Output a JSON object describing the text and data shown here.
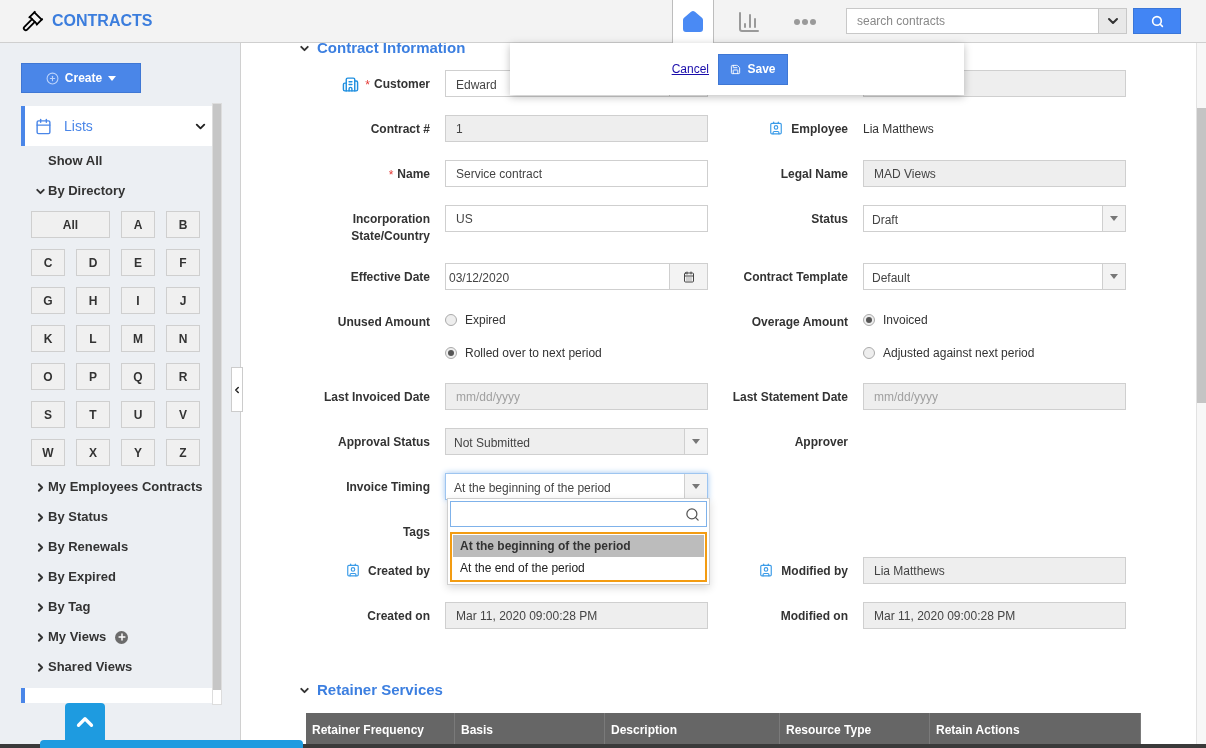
{
  "header": {
    "app_title": "CONTRACTS",
    "nav": [
      {
        "kind": "home",
        "selected": true
      },
      {
        "kind": "reports",
        "selected": false
      },
      {
        "kind": "more",
        "selected": false
      }
    ],
    "search": {
      "placeholder": "search contracts"
    }
  },
  "sidebar": {
    "create_label": "Create",
    "lists": {
      "label": "Lists",
      "expanded": true
    },
    "show_all": "Show All",
    "directory": {
      "label": "By Directory",
      "expanded": true,
      "letters": [
        "All",
        "A",
        "B",
        "C",
        "D",
        "E",
        "F",
        "G",
        "H",
        "I",
        "J",
        "K",
        "L",
        "M",
        "N",
        "O",
        "P",
        "Q",
        "R",
        "S",
        "T",
        "U",
        "V",
        "W",
        "X",
        "Y",
        "Z"
      ]
    },
    "groups": [
      {
        "label": "My Employees Contracts",
        "expanded": false,
        "addable": false
      },
      {
        "label": "By Status",
        "expanded": false,
        "addable": false
      },
      {
        "label": "By Renewals",
        "expanded": false,
        "addable": false
      },
      {
        "label": "By Expired",
        "expanded": false,
        "addable": false
      },
      {
        "label": "By Tag",
        "expanded": false,
        "addable": false
      },
      {
        "label": "My Views",
        "expanded": false,
        "addable": true
      },
      {
        "label": "Shared Views",
        "expanded": false,
        "addable": false
      }
    ]
  },
  "save_bar": {
    "cancel": "Cancel",
    "save": "Save"
  },
  "form": {
    "title": "Contract Information",
    "expanded": true,
    "rows": [
      {
        "left": {
          "label": "Customer",
          "required_mark": "*",
          "linked": true,
          "kind": "lookup",
          "value": "Edward",
          "disabled": false
        },
        "right": {
          "kind": "text",
          "disabled": true
        }
      },
      {
        "left": {
          "label": "Contract #",
          "linked": false,
          "kind": "text",
          "value": "1",
          "disabled": true
        },
        "right": {
          "label": "Employee",
          "linked": true,
          "kind": "value",
          "value": "Lia Matthews"
        }
      },
      {
        "left": {
          "label": "Name",
          "required_mark": "*",
          "linked": false,
          "kind": "text",
          "value": "Service contract",
          "disabled": false
        },
        "right": {
          "label": "Legal Name",
          "linked": false,
          "kind": "text",
          "value": "MAD Views",
          "disabled": true
        }
      },
      {
        "left": {
          "label": "Incorporation State/Country",
          "linked": false,
          "kind": "text",
          "value": "US",
          "disabled": false
        },
        "right": {
          "label": "Status",
          "linked": false,
          "kind": "select",
          "value": "Draft",
          "disabled": false
        }
      },
      {
        "left": {
          "label": "Effective Date",
          "linked": false,
          "kind": "date",
          "value": "03/12/2020",
          "disabled": false
        },
        "right": {
          "label": "Contract Template",
          "linked": false,
          "kind": "select",
          "value": "Default",
          "disabled": false
        }
      },
      {
        "left": {
          "label": "Unused Amount",
          "linked": false,
          "kind": "radios",
          "options": [
            {
              "label": "Expired",
              "selected": false
            },
            {
              "label": "Rolled over to next period",
              "selected": true
            }
          ]
        },
        "right": {
          "label": "Overage Amount",
          "linked": false,
          "kind": "radios",
          "options": [
            {
              "label": "Invoiced",
              "selected": true
            },
            {
              "label": "Adjusted against next period",
              "selected": false
            }
          ]
        }
      },
      {
        "left": {
          "label": "Last Invoiced Date",
          "linked": false,
          "kind": "text",
          "placeholder": "mm/dd/yyyy",
          "disabled": true
        },
        "right": {
          "label": "Last Statement Date",
          "linked": false,
          "kind": "text",
          "placeholder": "mm/dd/yyyy",
          "disabled": true
        }
      },
      {
        "left": {
          "label": "Approval Status",
          "linked": false,
          "kind": "select",
          "value": "Not Submitted",
          "disabled": true
        },
        "right": {
          "label": "Approver",
          "linked": false,
          "kind": "label"
        }
      },
      {
        "left": {
          "label": "Invoice Timing",
          "linked": false,
          "kind": "select",
          "value": "At the beginning of the period",
          "disabled": false,
          "open": true,
          "options": [
            {
              "label": "At the beginning of the period",
              "selected": true
            },
            {
              "label": "At the end of the period",
              "selected": false
            }
          ]
        },
        "right": {
          "kind": "empty"
        }
      },
      {
        "left": {
          "label": "Tags",
          "linked": false,
          "kind": "label"
        },
        "right": {
          "kind": "empty"
        }
      },
      {
        "left": {
          "label": "Created by",
          "linked": true,
          "kind": "label"
        },
        "right": {
          "label": "Modified by",
          "linked": true,
          "kind": "text",
          "value": "Lia Matthews",
          "disabled": true
        }
      },
      {
        "left": {
          "label": "Created on",
          "linked": false,
          "kind": "text",
          "value": "Mar 11, 2020 09:00:28 PM",
          "disabled": true
        },
        "right": {
          "label": "Modified on",
          "linked": false,
          "kind": "text",
          "value": "Mar 11, 2020 09:00:28 PM",
          "disabled": true
        }
      }
    ]
  },
  "retainer": {
    "title": "Retainer Services",
    "expanded": true,
    "columns": [
      "Retainer Frequency",
      "Basis",
      "Description",
      "Resource Type",
      "Retain Actions"
    ]
  }
}
